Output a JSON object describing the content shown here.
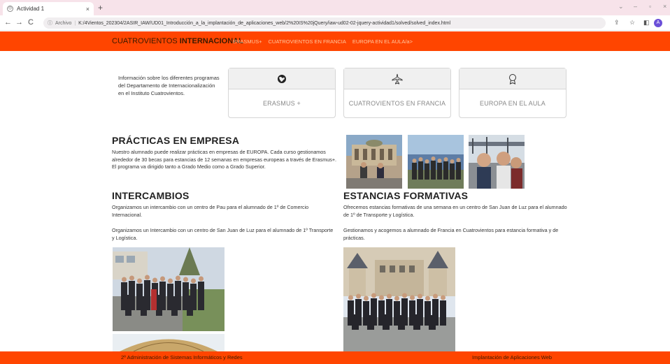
{
  "browser": {
    "tab_title": "Actividad 1",
    "tab_close": "×",
    "new_tab": "+",
    "url_protocol": "Archivo",
    "url_path": "K:/4Vientos_202304/2ASIR_IAW/UD01_Introducción_a_la_implantación_de_aplicaciones_web/2%20IS%20jQuery/iaw-ud02-02-jquery-actividad1/solved/solved_index.html",
    "profile_initial": "A"
  },
  "navbar": {
    "brand_light": "CUATROVIENTOS ",
    "brand_bold": "INTERNACIONAL",
    "links": [
      "ERASMUS+",
      "CUATROVIENTOS EN FRANCIA",
      "EUROPA EN EL AULA/a>"
    ]
  },
  "intro": {
    "text": "Información sobre los diferentes programas del Departamento de Internacionalización en el Instituto Cuatrovientos."
  },
  "cards": [
    {
      "icon": "globe-icon",
      "label": "ERASMUS +"
    },
    {
      "icon": "airplane-icon",
      "label": "CUATROVIENTOS EN FRANCIA"
    },
    {
      "icon": "award-icon",
      "label": "EUROPA EN EL AULA"
    }
  ],
  "practicas": {
    "title": "PRÁCTICAS EN EMPRESA",
    "text": "Nuestro alumnado puede realizar prácticas en empresas de EUROPA. Cada curso gestionamos alrededor de 30 becas para estancias de 12 semanas en empresas europeas a través de Erasmus+. El programa va dirigido tanto a Grado Medio como a Grado Superior."
  },
  "intercambios": {
    "title": "INTERCAMBIOS",
    "p1": "Organizamos un intercambio con un centro de Pau para el alumnado de 1º de Comercio Internacional.",
    "p2": "Organizamos un Intercambio con un centro de San Juan de Luz para el alumnado de 1º Transporte y Logística."
  },
  "estancias": {
    "title": "ESTANCIAS FORMATIVAS",
    "p1": "Ofrecemos estancias formativas de una semana en un centro de San Juan de Luz para el alumnado de 1º de Transporte y Logística.",
    "p2": "Gestionamos y acogemos a alumnado de Francia en Cuatrovientos para estancia formativa y de prácticas."
  },
  "footer": {
    "left": "2º Administración de Sistemas Informáticos y Redes",
    "right": "Implantación de Aplicaciones Web"
  },
  "colors": {
    "brand": "#ff4500",
    "tabbar": "#f7e3ea"
  }
}
